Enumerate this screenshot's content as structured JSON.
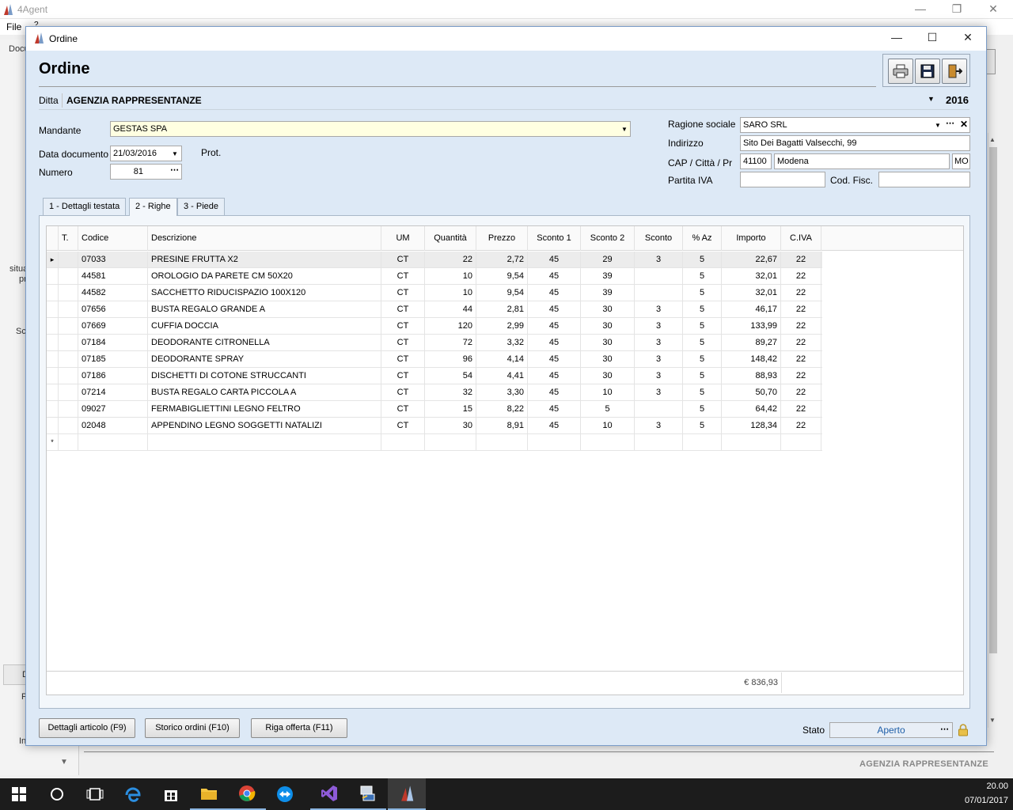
{
  "app": {
    "title": "4Agent",
    "menu_file": "File",
    "menu_help": "?",
    "left_fragments": [
      "Docu",
      "situa",
      "pr",
      "Sc",
      "D",
      "P",
      "In"
    ],
    "footer_brand": "AGENZIA RAPPRESENTANZE"
  },
  "dialog": {
    "window_title": "Ordine",
    "header_title": "Ordine",
    "ditta": {
      "label": "Ditta",
      "value": "AGENZIA RAPPRESENTANZE",
      "year": "2016"
    },
    "left_fields": {
      "mandante_label": "Mandante",
      "mandante_value": "GESTAS SPA",
      "data_label": "Data documento",
      "data_value": "21/03/2016",
      "prot_label": "Prot.",
      "numero_label": "Numero",
      "numero_value": "81"
    },
    "right_fields": {
      "ragione_label": "Ragione sociale",
      "ragione_value": "SARO SRL",
      "indirizzo_label": "Indirizzo",
      "indirizzo_value": "Sito Dei Bagatti Valsecchi, 99",
      "cap_label": "CAP / Città / Pr",
      "cap_value": "41100",
      "citta_value": "Modena",
      "pr_value": "MO",
      "piva_label": "Partita IVA",
      "piva_value": "",
      "codfisc_label": "Cod. Fisc.",
      "codfisc_value": ""
    },
    "tabs": [
      {
        "label": "1 - Dettagli testata"
      },
      {
        "label": "2 - Righe"
      },
      {
        "label": "3 - Piede"
      }
    ],
    "active_tab": 1,
    "grid": {
      "columns": [
        "T.",
        "Codice",
        "Descrizione",
        "UM",
        "Quantità",
        "Prezzo",
        "Sconto 1",
        "Sconto 2",
        "Sconto",
        "% Az",
        "Importo",
        "C.IVA"
      ],
      "rows": [
        [
          "07033",
          "PRESINE FRUTTA X2",
          "CT",
          "22",
          "2,72",
          "45",
          "29",
          "3",
          "5",
          "22,67",
          "22"
        ],
        [
          "44581",
          "OROLOGIO DA PARETE CM 50X20",
          "CT",
          "10",
          "9,54",
          "45",
          "39",
          "",
          "5",
          "32,01",
          "22"
        ],
        [
          "44582",
          "SACCHETTO RIDUCISPAZIO 100X120",
          "CT",
          "10",
          "9,54",
          "45",
          "39",
          "",
          "5",
          "32,01",
          "22"
        ],
        [
          "07656",
          "BUSTA REGALO GRANDE A",
          "CT",
          "44",
          "2,81",
          "45",
          "30",
          "3",
          "5",
          "46,17",
          "22"
        ],
        [
          "07669",
          "CUFFIA DOCCIA",
          "CT",
          "120",
          "2,99",
          "45",
          "30",
          "3",
          "5",
          "133,99",
          "22"
        ],
        [
          "07184",
          "DEODORANTE CITRONELLA",
          "CT",
          "72",
          "3,32",
          "45",
          "30",
          "3",
          "5",
          "89,27",
          "22"
        ],
        [
          "07185",
          "DEODORANTE SPRAY",
          "CT",
          "96",
          "4,14",
          "45",
          "30",
          "3",
          "5",
          "148,42",
          "22"
        ],
        [
          "07186",
          "DISCHETTI DI COTONE STRUCCANTI",
          "CT",
          "54",
          "4,41",
          "45",
          "30",
          "3",
          "5",
          "88,93",
          "22"
        ],
        [
          "07214",
          "BUSTA REGALO CARTA PICCOLA A",
          "CT",
          "32",
          "3,30",
          "45",
          "10",
          "3",
          "5",
          "50,70",
          "22"
        ],
        [
          "09027",
          "FERMABIGLIETTINI LEGNO FELTRO",
          "CT",
          "15",
          "8,22",
          "45",
          "5",
          "",
          "5",
          "64,42",
          "22"
        ],
        [
          "02048",
          "APPENDINO LEGNO SOGGETTI NATALIZI",
          "CT",
          "30",
          "8,91",
          "45",
          "10",
          "3",
          "5",
          "128,34",
          "22"
        ]
      ],
      "new_row_marker": "*",
      "current_row_marker": "▸",
      "total": "€ 836,93"
    },
    "buttons": {
      "dettagli": "Dettagli articolo (F9)",
      "storico": "Storico ordini (F10)",
      "riga_offerta": "Riga offerta (F11)"
    },
    "stato": {
      "label": "Stato",
      "value": "Aperto"
    }
  },
  "taskbar": {
    "time": "20.00",
    "date": "07/01/2017",
    "icons": [
      "windows-start-icon",
      "cortana-icon",
      "task-view-icon",
      "edge-icon",
      "store-icon",
      "file-explorer-icon",
      "chrome-icon",
      "teamviewer-icon",
      "visual-studio-icon",
      "network-app-icon",
      "4agent-icon"
    ]
  },
  "colors": {
    "dialog_bg": "#dde9f6",
    "mandante_bg": "#ffffe1",
    "stato_text": "#1f5fa8",
    "taskbar_bg": "#1c1c1c"
  }
}
